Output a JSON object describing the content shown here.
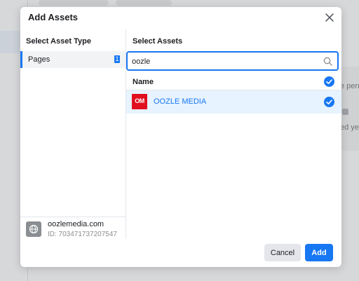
{
  "background": {
    "partial_text_1": "e perm",
    "partial_text_2": "ed yet"
  },
  "modal": {
    "title": "Add Assets",
    "close_icon": "close-icon"
  },
  "asset_types": {
    "heading": "Select Asset Type",
    "items": [
      {
        "label": "Pages",
        "count": "1",
        "selected": true
      }
    ]
  },
  "business": {
    "name": "oozlemedia.com",
    "id_text": "ID: 703471737207547",
    "icon": "globe-icon"
  },
  "assets": {
    "heading": "Select Assets",
    "search": {
      "value": "oozle",
      "placeholder": ""
    },
    "column_header": "Name",
    "rows": [
      {
        "name": "OOZLE MEDIA",
        "logo_text": "OM",
        "checked": true
      }
    ]
  },
  "footer": {
    "cancel_label": "Cancel",
    "add_label": "Add"
  },
  "colors": {
    "accent": "#1877f2",
    "selected_row": "#e7f3ff",
    "logo_red": "#e0101f"
  }
}
